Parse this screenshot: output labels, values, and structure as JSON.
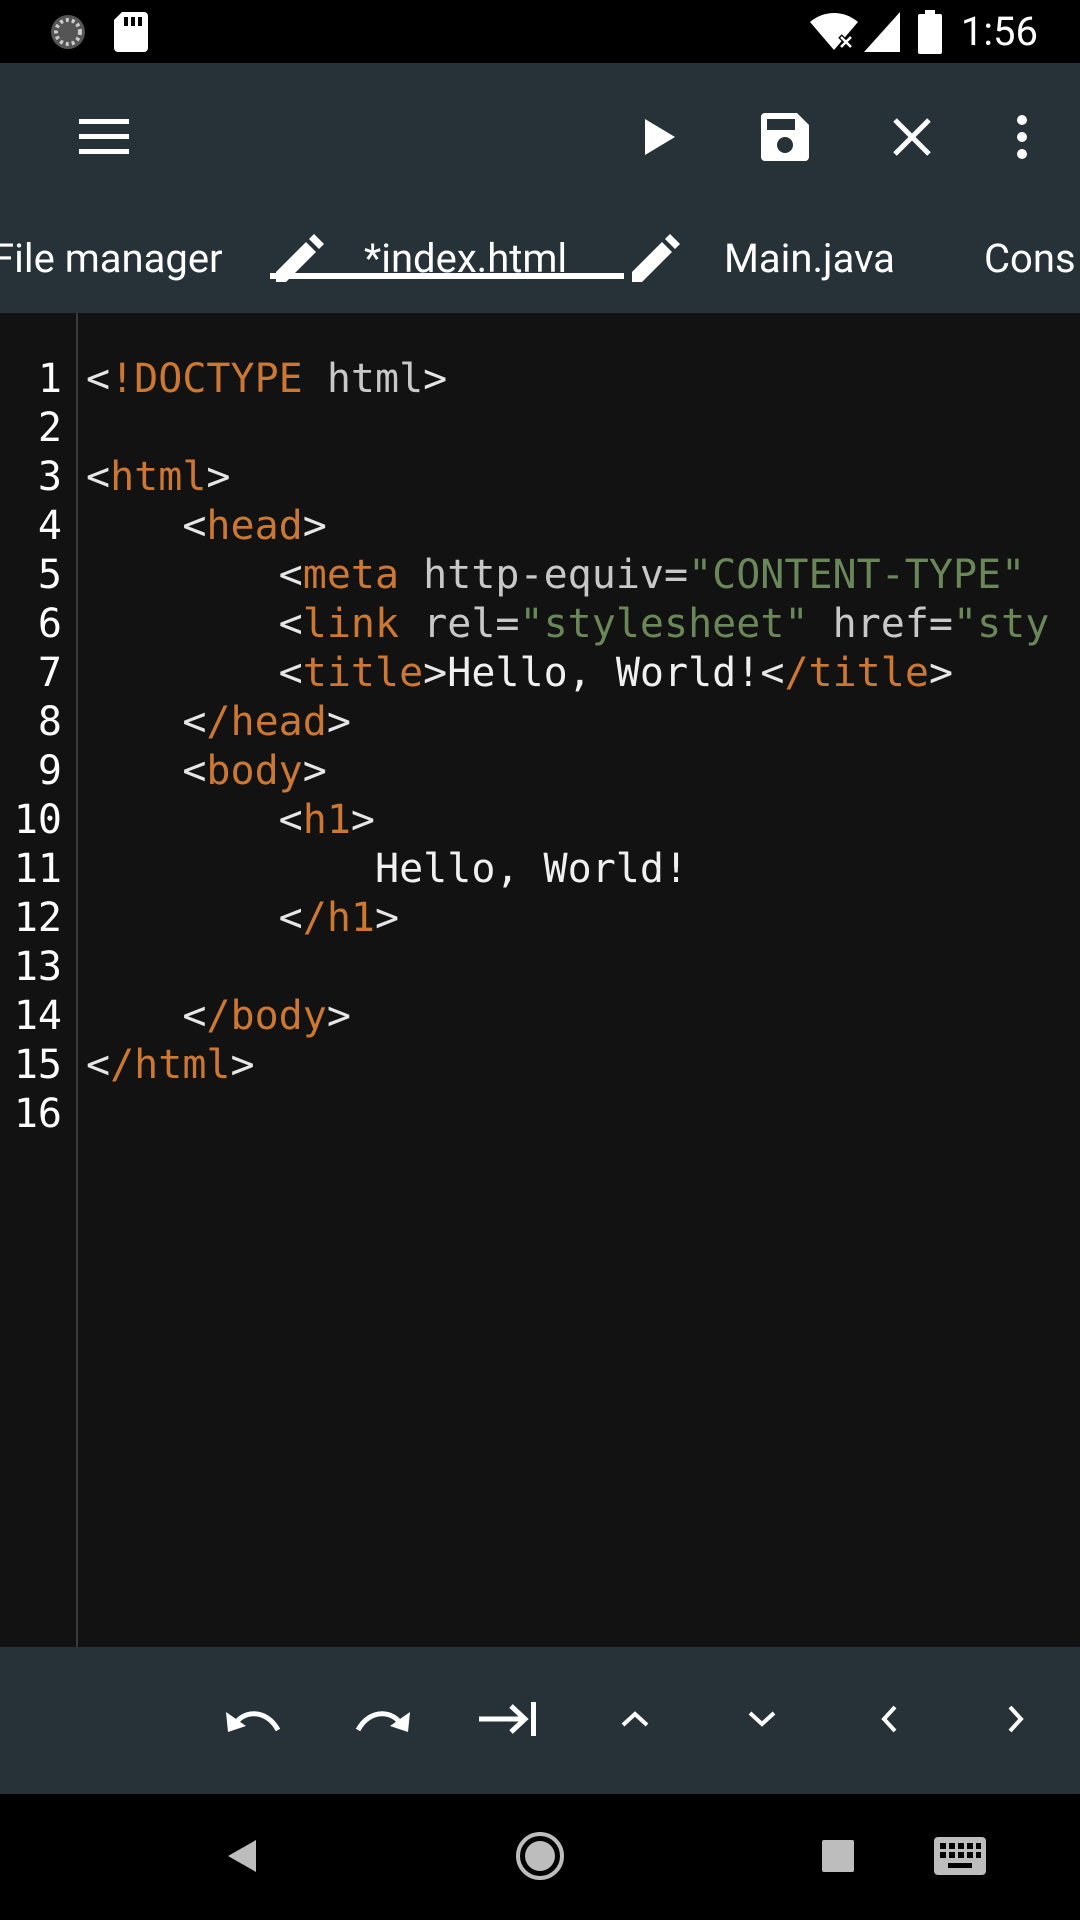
{
  "status_bar": {
    "time": "1:56",
    "icons": [
      "sync-icon",
      "sd-card-icon",
      "wifi-off-icon",
      "signal-icon",
      "battery-icon"
    ]
  },
  "toolbar": {
    "actions": [
      "menu-icon",
      "run-icon",
      "save-icon",
      "close-icon",
      "more-vert-icon"
    ],
    "tabs": [
      {
        "label": "File manager",
        "modified": false,
        "active": false
      },
      {
        "label": "*index.html",
        "modified": true,
        "active": true
      },
      {
        "label": "Main.java",
        "modified": false,
        "active": false
      },
      {
        "label": "Cons",
        "modified": false,
        "active": false
      }
    ]
  },
  "editor": {
    "line_numbers": [
      "1",
      "2",
      "3",
      "4",
      "5",
      "6",
      "7",
      "8",
      "9",
      "10",
      "11",
      "12",
      "13",
      "14",
      "15",
      "16"
    ],
    "lines": [
      [
        {
          "t": "punct",
          "v": "<"
        },
        {
          "t": "tag",
          "v": "!DOCTYPE"
        },
        {
          "t": "attr",
          "v": " html"
        },
        {
          "t": "punct",
          "v": ">"
        }
      ],
      [],
      [
        {
          "t": "punct",
          "v": "<"
        },
        {
          "t": "tag",
          "v": "html"
        },
        {
          "t": "punct",
          "v": ">"
        }
      ],
      [
        {
          "t": "punct",
          "v": "    <"
        },
        {
          "t": "tag",
          "v": "head"
        },
        {
          "t": "punct",
          "v": ">"
        }
      ],
      [
        {
          "t": "punct",
          "v": "        <"
        },
        {
          "t": "tag",
          "v": "meta"
        },
        {
          "t": "attr",
          "v": " http-equiv="
        },
        {
          "t": "str",
          "v": "\"CONTENT-TYPE\""
        }
      ],
      [
        {
          "t": "punct",
          "v": "        <"
        },
        {
          "t": "tag",
          "v": "link"
        },
        {
          "t": "attr",
          "v": " rel="
        },
        {
          "t": "str",
          "v": "\"stylesheet\""
        },
        {
          "t": "attr",
          "v": " href="
        },
        {
          "t": "str",
          "v": "\"sty"
        }
      ],
      [
        {
          "t": "punct",
          "v": "        <"
        },
        {
          "t": "tag",
          "v": "title"
        },
        {
          "t": "punct",
          "v": ">"
        },
        {
          "t": "txt",
          "v": "Hello, World!"
        },
        {
          "t": "punct",
          "v": "<"
        },
        {
          "t": "tag",
          "v": "/title"
        },
        {
          "t": "punct",
          "v": ">"
        }
      ],
      [
        {
          "t": "punct",
          "v": "    <"
        },
        {
          "t": "tag",
          "v": "/head"
        },
        {
          "t": "punct",
          "v": ">"
        }
      ],
      [
        {
          "t": "punct",
          "v": "    <"
        },
        {
          "t": "tag",
          "v": "body"
        },
        {
          "t": "punct",
          "v": ">"
        }
      ],
      [
        {
          "t": "punct",
          "v": "        <"
        },
        {
          "t": "tag",
          "v": "h1"
        },
        {
          "t": "punct",
          "v": ">"
        }
      ],
      [
        {
          "t": "txt",
          "v": "            Hello, World!"
        }
      ],
      [
        {
          "t": "punct",
          "v": "        <"
        },
        {
          "t": "tag",
          "v": "/h1"
        },
        {
          "t": "punct",
          "v": ">"
        }
      ],
      [],
      [
        {
          "t": "punct",
          "v": "    <"
        },
        {
          "t": "tag",
          "v": "/body"
        },
        {
          "t": "punct",
          "v": ">"
        }
      ],
      [
        {
          "t": "punct",
          "v": "<"
        },
        {
          "t": "tag",
          "v": "/html"
        },
        {
          "t": "punct",
          "v": ">"
        }
      ],
      []
    ]
  },
  "bottom_bar": {
    "actions": [
      "undo-icon",
      "redo-icon",
      "tab-indent-icon",
      "chevron-up-icon",
      "chevron-down-icon",
      "chevron-left-icon",
      "chevron-right-icon"
    ]
  },
  "nav_bar": {
    "buttons": [
      "back-icon",
      "home-icon",
      "recents-icon",
      "keyboard-icon"
    ]
  },
  "colors": {
    "toolbar_bg": "#263238",
    "editor_bg": "#121212",
    "tag": "#cc7832",
    "string": "#6a8759",
    "attr": "#c8c8c8"
  }
}
